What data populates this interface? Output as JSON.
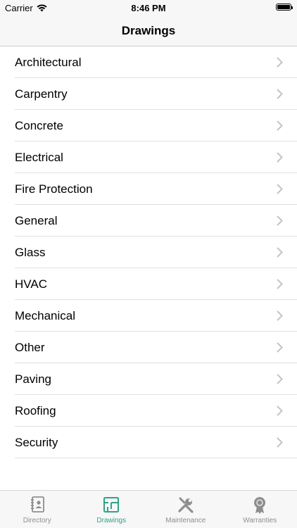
{
  "status": {
    "carrier": "Carrier",
    "time": "8:46 PM"
  },
  "nav": {
    "title": "Drawings"
  },
  "list": {
    "items": [
      {
        "label": "Architectural"
      },
      {
        "label": "Carpentry"
      },
      {
        "label": "Concrete"
      },
      {
        "label": "Electrical"
      },
      {
        "label": "Fire Protection"
      },
      {
        "label": "General"
      },
      {
        "label": "Glass"
      },
      {
        "label": "HVAC"
      },
      {
        "label": "Mechanical"
      },
      {
        "label": "Other"
      },
      {
        "label": "Paving"
      },
      {
        "label": "Roofing"
      },
      {
        "label": "Security"
      }
    ]
  },
  "tabs": [
    {
      "label": "Directory",
      "icon": "contacts-book-icon",
      "active": false
    },
    {
      "label": "Drawings",
      "icon": "floor-plan-icon",
      "active": true
    },
    {
      "label": "Maintenance",
      "icon": "tools-icon",
      "active": false
    },
    {
      "label": "Warranties",
      "icon": "award-seal-icon",
      "active": false
    }
  ],
  "colors": {
    "accent": "#2fa388",
    "inactive": "#8e8e8e",
    "chevron": "#c4c4c7",
    "separator": "#e0e0e0"
  }
}
